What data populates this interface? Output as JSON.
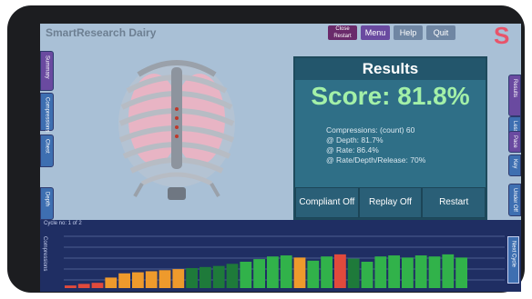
{
  "app": {
    "title": "SmartResearch Dairy"
  },
  "topbar": {
    "close_label": "Close Restart",
    "menu_label": "Menu",
    "help_label": "Help",
    "quit_label": "Quit",
    "logo": "S"
  },
  "left_tabs": [
    "Summary",
    "Compressions",
    "Chest",
    "Depth"
  ],
  "right_tabs": [
    "Results",
    "Lesson",
    "Pace",
    "Key",
    "Under Off"
  ],
  "results": {
    "title": "Results",
    "score": "Score: 81.8%",
    "stats": [
      "Compressions: (count) 60",
      "@ Depth: 81.7%",
      "@ Rate: 86.4%",
      "@ Rate/Depth/Release: 70%"
    ],
    "buttons": [
      "Compliant Off",
      "Replay Off",
      "Restart"
    ]
  },
  "chart": {
    "cycle_label": "Cycle no: 1 of 2",
    "y_label": "Compressions",
    "next_label": "Next Cycle"
  },
  "chart_data": {
    "type": "bar",
    "values": [
      0.05,
      0.08,
      0.1,
      0.2,
      0.28,
      0.3,
      0.32,
      0.34,
      0.36,
      0.38,
      0.4,
      0.42,
      0.46,
      0.5,
      0.55,
      0.6,
      0.62,
      0.58,
      0.52,
      0.6,
      0.64,
      0.56,
      0.5,
      0.6,
      0.62,
      0.58,
      0.62,
      0.6,
      0.64,
      0.58
    ],
    "colors": [
      "#e14a3c",
      "#e14a3c",
      "#e14a3c",
      "#ee9a2c",
      "#ee9a2c",
      "#ee9a2c",
      "#ee9a2c",
      "#ee9a2c",
      "#ee9a2c",
      "#1e7a3a",
      "#1e7a3a",
      "#1e7a3a",
      "#1e7a3a",
      "#31b24a",
      "#31b24a",
      "#31b24a",
      "#31b24a",
      "#ee9a2c",
      "#31b24a",
      "#31b24a",
      "#e14a3c",
      "#1e7a3a",
      "#31b24a",
      "#31b24a",
      "#31b24a",
      "#31b24a",
      "#31b24a",
      "#31b24a",
      "#31b24a",
      "#31b24a"
    ]
  }
}
